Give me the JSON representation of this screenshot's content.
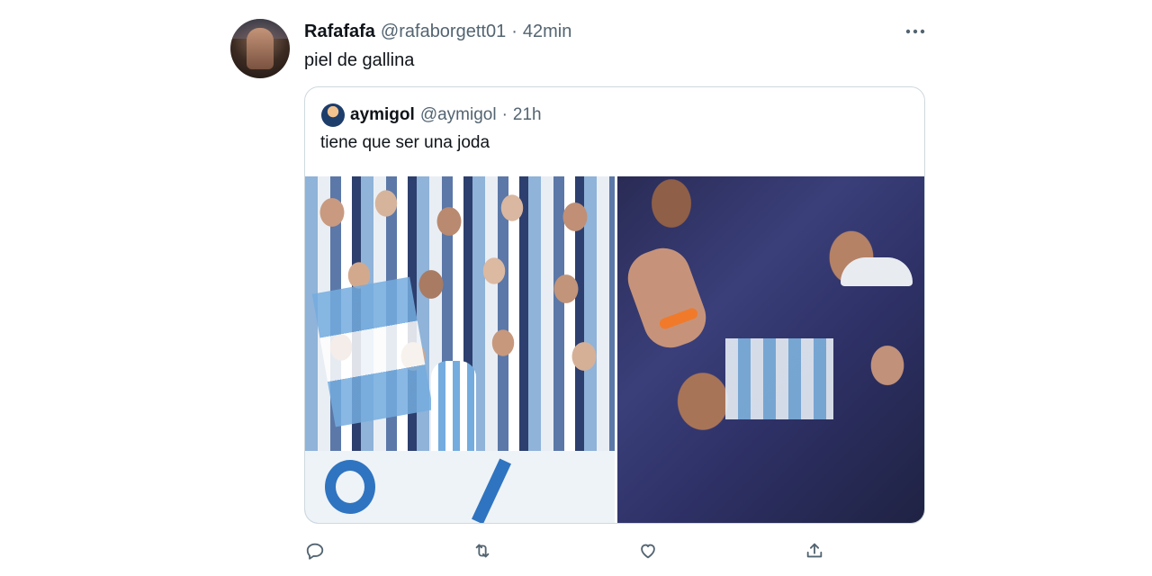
{
  "tweet": {
    "author_name": "Rafafafa",
    "author_handle": "@rafaborgett01",
    "separator": "·",
    "time": "42min",
    "more_icon": "more-horizontal-icon",
    "text": "piel de gallina"
  },
  "quoted": {
    "author_name": "aymigol",
    "author_handle": "@aymigol",
    "separator": "·",
    "time": "21h",
    "text": "tiene que ser una joda"
  },
  "actions": [
    {
      "name": "reply",
      "icon": "reply-icon"
    },
    {
      "name": "retweet",
      "icon": "retweet-icon"
    },
    {
      "name": "like",
      "icon": "heart-icon"
    },
    {
      "name": "share",
      "icon": "share-icon"
    }
  ],
  "colors": {
    "text_primary": "#0f1419",
    "text_secondary": "#536471",
    "border": "#cfd9de"
  }
}
